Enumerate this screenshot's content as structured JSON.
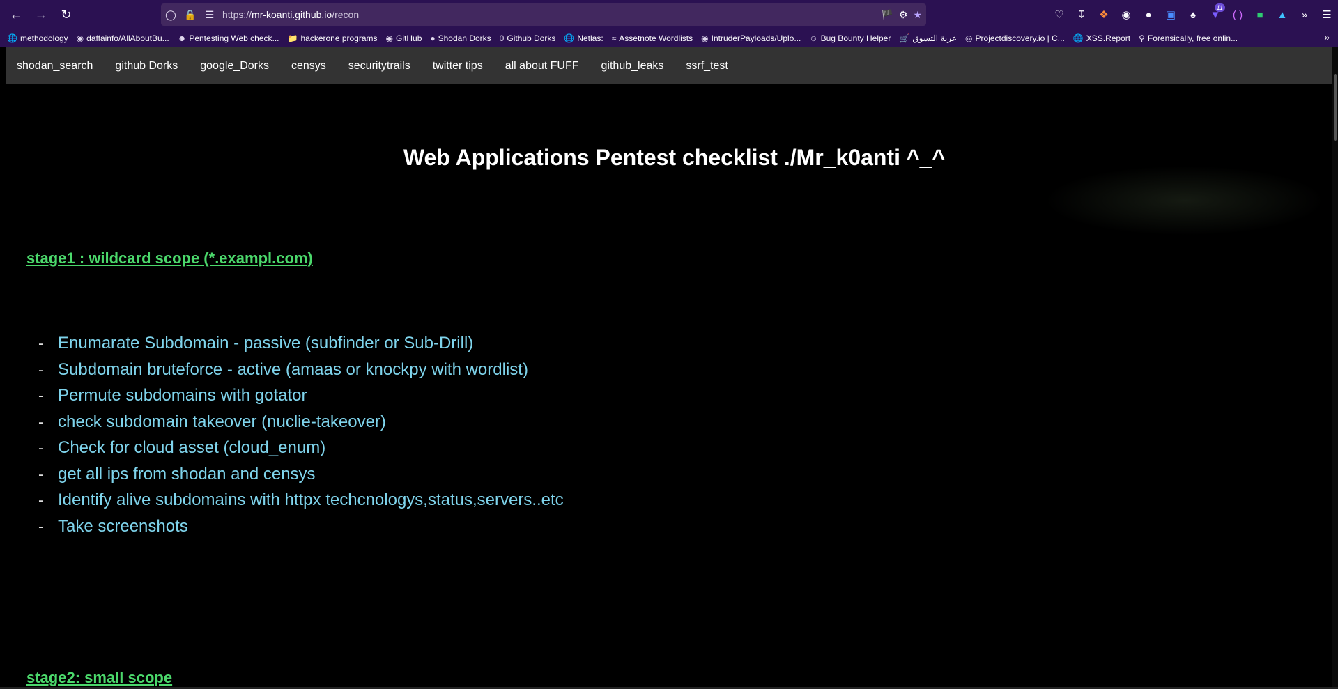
{
  "browser": {
    "url_prefix": "https://",
    "url_host": "mr-koanti.github.io",
    "url_path": "/recon",
    "extension_badge": "11"
  },
  "bookmarks": [
    {
      "label": "methodology",
      "icon": "globe-icon"
    },
    {
      "label": "daffainfo/AllAboutBu...",
      "icon": "github-icon"
    },
    {
      "label": "Pentesting Web check...",
      "icon": "hacker-icon"
    },
    {
      "label": "hackerone programs",
      "icon": "folder-icon"
    },
    {
      "label": "GitHub",
      "icon": "github-icon"
    },
    {
      "label": "Shodan Dorks",
      "icon": "shodan-icon"
    },
    {
      "label": "Github Dorks",
      "icon": "zero-icon"
    },
    {
      "label": "Netlas:",
      "icon": "globe-icon"
    },
    {
      "label": "Assetnote Wordlists",
      "icon": "wave-icon"
    },
    {
      "label": "IntruderPayloads/Uplo...",
      "icon": "github-icon"
    },
    {
      "label": "Bug Bounty Helper",
      "icon": "emoji-icon"
    },
    {
      "label": "عربة التسوق",
      "icon": "cart-icon"
    },
    {
      "label": "Projectdiscovery.io | C...",
      "icon": "circle-icon"
    },
    {
      "label": "XSS.Report",
      "icon": "globe-icon"
    },
    {
      "label": "Forensically, free onlin...",
      "icon": "magnifier-icon"
    }
  ],
  "site_nav": [
    "shodan_search",
    "github Dorks",
    "google_Dorks",
    "censys",
    "securitytrails",
    "twitter tips",
    "all about FUFF",
    "github_leaks",
    "ssrf_test"
  ],
  "page": {
    "title": "Web Applications Pentest checklist ./Mr_k0anti ^_^",
    "stage1": "stage1 : wildcard scope (*.exampl.com)",
    "stage1_steps": [
      "Enumarate Subdomain - passive (subfinder or Sub-Drill)",
      "Subdomain bruteforce - active (amaas or knockpy with wordlist)",
      "Permute subdomains with gotator",
      "check subdomain takeover (nuclie-takeover)",
      "Check for cloud asset (cloud_enum)",
      "get all ips from shodan and censys",
      "Identify alive subdomains with httpx techcnologys,status,servers..etc",
      "Take screenshots"
    ],
    "stage2": "stage2: small scope",
    "bullet": "-"
  },
  "colors": {
    "chrome": "#2b1152",
    "urlbar": "#42285f",
    "nav_bg": "#333333",
    "stage_heading": "#4bd86b",
    "step_text": "#7fd4ec"
  }
}
